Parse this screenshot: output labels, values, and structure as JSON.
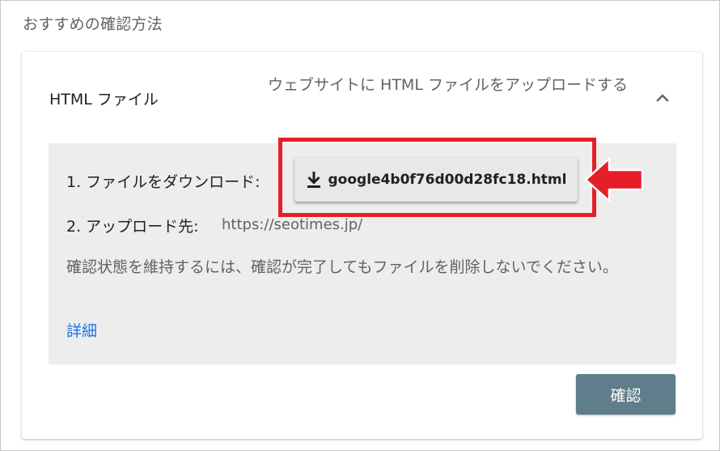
{
  "section_title": "おすすめの確認方法",
  "method": {
    "name": "HTML ファイル",
    "description": "ウェブサイトに HTML ファイルをアップロードする",
    "expanded_icon": "chevron-up-icon"
  },
  "steps": {
    "download_label": "1. ファイルをダウンロード:",
    "download_icon": "download-icon",
    "download_filename": "google4b0f76d00d28fc18.html",
    "upload_label": "2. アップロード先:",
    "upload_url": "https://seotimes.jp/"
  },
  "note": "確認状態を維持するには、確認が完了してもファイルを削除しないでください。",
  "details_link": "詳細",
  "confirm_button": "確認",
  "annotation": {
    "highlight_color": "#e51e2a",
    "arrow_icon": "red-arrow-left-icon"
  },
  "colors": {
    "link": "#1a73e8",
    "confirm_button_bg": "#607d8b",
    "panel_bg": "#ededed"
  }
}
